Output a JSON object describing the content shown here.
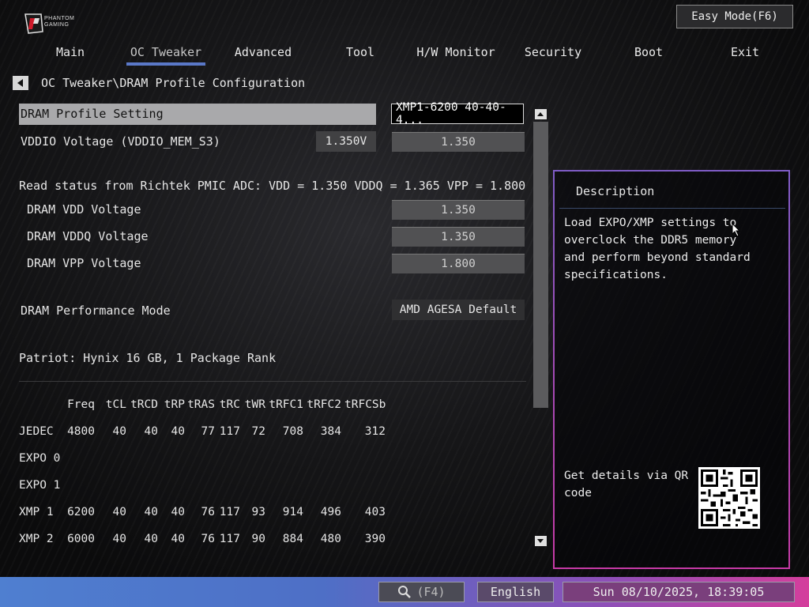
{
  "header": {
    "logo_text_line1": "PHANTOM",
    "logo_text_line2": "GAMING",
    "easy_mode_label": "Easy Mode(F6)"
  },
  "nav": {
    "tabs": [
      {
        "label": "Main"
      },
      {
        "label": "OC Tweaker"
      },
      {
        "label": "Advanced"
      },
      {
        "label": "Tool"
      },
      {
        "label": "H/W Monitor"
      },
      {
        "label": "Security"
      },
      {
        "label": "Boot"
      },
      {
        "label": "Exit"
      }
    ],
    "active_tab": "OC Tweaker"
  },
  "breadcrumb": "OC Tweaker\\DRAM Profile Configuration",
  "settings": {
    "profile_setting": {
      "label": "DRAM Profile Setting",
      "value": "XMP1-6200 40-40-4..."
    },
    "vddio": {
      "label": "VDDIO Voltage (VDDIO_MEM_S3)",
      "current": "1.350V",
      "value": "1.350"
    },
    "pmic_status": "Read status from Richtek PMIC ADC: VDD = 1.350 VDDQ = 1.365 VPP = 1.800",
    "vdd": {
      "label": "DRAM VDD Voltage",
      "value": "1.350"
    },
    "vddq": {
      "label": "DRAM VDDQ Voltage",
      "value": "1.350"
    },
    "vpp": {
      "label": "DRAM VPP Voltage",
      "value": "1.800"
    },
    "perf_mode": {
      "label": "DRAM Performance Mode",
      "value": "AMD AGESA Default"
    },
    "module_info": "Patriot: Hynix 16 GB, 1 Package Rank"
  },
  "timings": {
    "columns": [
      "Freq",
      "tCL",
      "tRCD",
      "tRP",
      "tRAS",
      "tRC",
      "tWR",
      "tRFC1",
      "tRFC2",
      "tRFCSb"
    ],
    "rows": [
      {
        "name": "JEDEC",
        "values": [
          "4800",
          "40",
          "40",
          "40",
          "77",
          "117",
          "72",
          "708",
          "384",
          "312"
        ]
      },
      {
        "name": "EXPO 0",
        "values": [
          "",
          "",
          "",
          "",
          "",
          "",
          "",
          "",
          "",
          ""
        ]
      },
      {
        "name": "EXPO 1",
        "values": [
          "",
          "",
          "",
          "",
          "",
          "",
          "",
          "",
          "",
          ""
        ]
      },
      {
        "name": "XMP 1",
        "values": [
          "6200",
          "40",
          "40",
          "40",
          "76",
          "117",
          "93",
          "914",
          "496",
          "403"
        ]
      },
      {
        "name": "XMP 2",
        "values": [
          "6000",
          "40",
          "40",
          "40",
          "76",
          "117",
          "90",
          "884",
          "480",
          "390"
        ]
      }
    ]
  },
  "description": {
    "title": "Description",
    "text": "Load EXPO/XMP settings to overclock the DDR5 memory and perform beyond standard specifications.",
    "qr_text": "Get details via QR code"
  },
  "footer": {
    "search_label": "(F4)",
    "language": "English",
    "datetime": "Sun 08/10/2025, 18:39:05"
  }
}
